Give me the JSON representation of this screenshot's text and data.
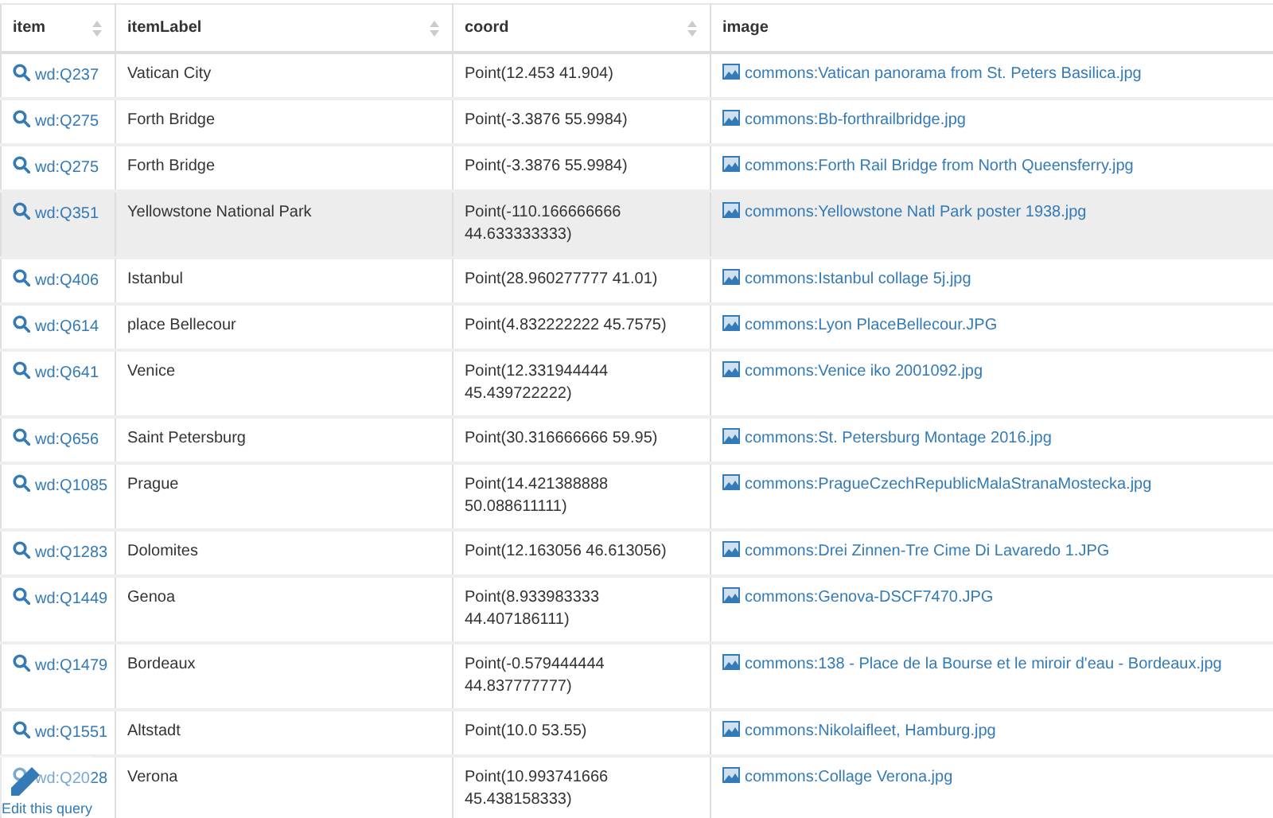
{
  "table": {
    "columns": [
      {
        "label": "item",
        "sortable": true
      },
      {
        "label": "itemLabel",
        "sortable": true
      },
      {
        "label": "coord",
        "sortable": true
      },
      {
        "label": "image",
        "sortable": false
      }
    ],
    "rows": [
      {
        "item": "wd:Q237",
        "label": "Vatican City",
        "coord": "Point(12.453 41.904)",
        "image": "commons:Vatican panorama from St. Peters Basilica.jpg",
        "highlighted": false
      },
      {
        "item": "wd:Q275",
        "label": "Forth Bridge",
        "coord": "Point(-3.3876 55.9984)",
        "image": "commons:Bb-forthrailbridge.jpg",
        "highlighted": false
      },
      {
        "item": "wd:Q275",
        "label": "Forth Bridge",
        "coord": "Point(-3.3876 55.9984)",
        "image": "commons:Forth Rail Bridge from North Queensferry.jpg",
        "highlighted": false
      },
      {
        "item": "wd:Q351",
        "label": "Yellowstone National Park",
        "coord": "Point(-110.166666666 44.633333333)",
        "image": "commons:Yellowstone Natl Park poster 1938.jpg",
        "highlighted": true
      },
      {
        "item": "wd:Q406",
        "label": "Istanbul",
        "coord": "Point(28.960277777 41.01)",
        "image": "commons:Istanbul collage 5j.jpg",
        "highlighted": false
      },
      {
        "item": "wd:Q614",
        "label": "place Bellecour",
        "coord": "Point(4.832222222 45.7575)",
        "image": "commons:Lyon PlaceBellecour.JPG",
        "highlighted": false
      },
      {
        "item": "wd:Q641",
        "label": "Venice",
        "coord": "Point(12.331944444 45.439722222)",
        "image": "commons:Venice iko 2001092.jpg",
        "highlighted": false
      },
      {
        "item": "wd:Q656",
        "label": "Saint Petersburg",
        "coord": "Point(30.316666666 59.95)",
        "image": "commons:St. Petersburg Montage 2016.jpg",
        "highlighted": false
      },
      {
        "item": "wd:Q1085",
        "label": "Prague",
        "coord": "Point(14.421388888 50.088611111)",
        "image": "commons:PragueCzechRepublicMalaStranaMostecka.jpg",
        "highlighted": false
      },
      {
        "item": "wd:Q1283",
        "label": "Dolomites",
        "coord": "Point(12.163056 46.613056)",
        "image": "commons:Drei Zinnen-Tre Cime Di Lavaredo 1.JPG",
        "highlighted": false
      },
      {
        "item": "wd:Q1449",
        "label": "Genoa",
        "coord": "Point(8.933983333 44.407186111)",
        "image": "commons:Genova-DSCF7470.JPG",
        "highlighted": false
      },
      {
        "item": "wd:Q1479",
        "label": "Bordeaux",
        "coord": "Point(-0.579444444 44.837777777)",
        "image": "commons:138 - Place de la Bourse et le miroir d'eau - Bordeaux.jpg",
        "highlighted": false
      },
      {
        "item": "wd:Q1551",
        "label": "Altstadt",
        "coord": "Point(10.0 53.55)",
        "image": "commons:Nikolaifleet, Hamburg.jpg",
        "highlighted": false
      },
      {
        "item": "wd:Q2028",
        "label": "Verona",
        "coord": "Point(10.993741666 45.438158333)",
        "image": "commons:Collage Verona.jpg",
        "highlighted": false
      }
    ]
  },
  "edit_query": {
    "label": "Edit this query"
  }
}
